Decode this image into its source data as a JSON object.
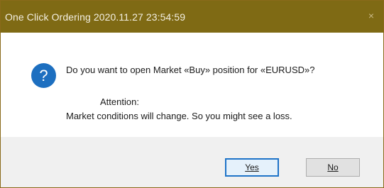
{
  "window": {
    "title": "One Click Ordering 2020.11.27 23:54:59",
    "close_glyph": "×"
  },
  "message": {
    "question": "Do you want to open Market «Buy» position for «EURUSD»?",
    "attention": "Attention:",
    "warning": "Market conditions will change. So you might see a loss."
  },
  "icon": {
    "name": "question-icon",
    "color": "#1d6fc0"
  },
  "buttons": {
    "yes": "Yes",
    "no": "No"
  }
}
